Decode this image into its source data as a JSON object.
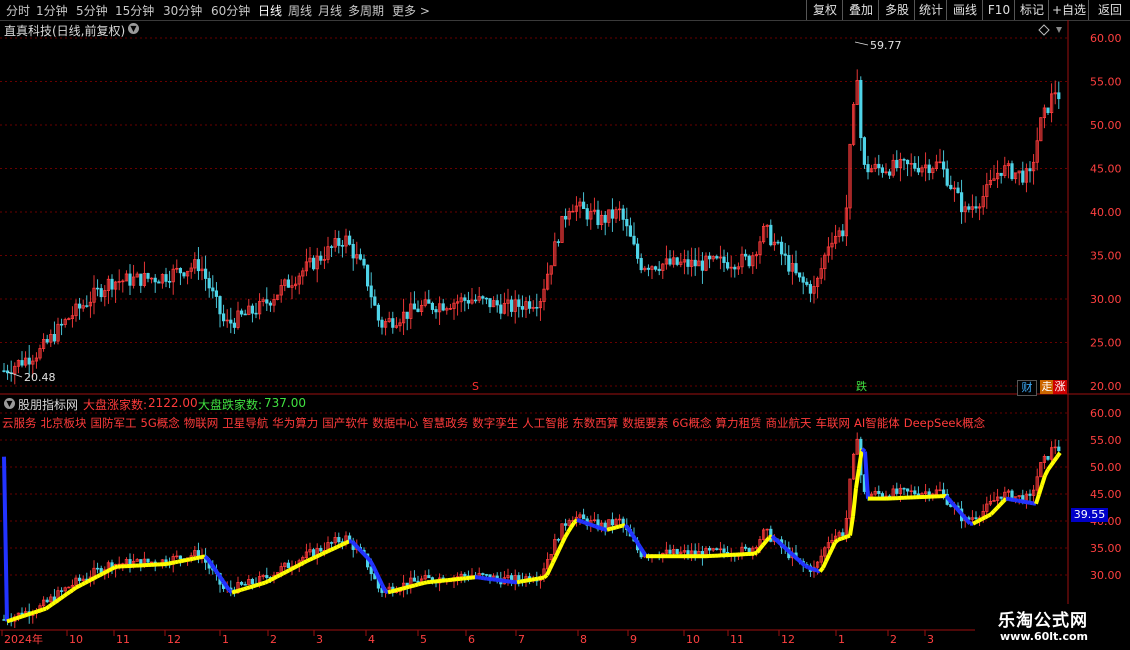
{
  "toolbar": {
    "left": [
      "分时",
      "1分钟",
      "5分钟",
      "15分钟",
      "30分钟",
      "60分钟",
      "日线",
      "周线",
      "月线",
      "多周期",
      "更多 >"
    ],
    "active": "日线",
    "right": [
      "复权",
      "叠加",
      "多股",
      "统计",
      "画线",
      "F10",
      "标记",
      "+自选",
      "返回"
    ]
  },
  "main": {
    "title": "直真科技(日线,前复权)",
    "high_label": "59.77",
    "low_label": "20.48",
    "axis": [
      "60.00",
      "55.00",
      "50.00",
      "45.00",
      "40.00",
      "35.00",
      "30.00",
      "25.00",
      "20.00"
    ],
    "marker_s": "S",
    "marker_die": "跌",
    "badge_cai": "财",
    "badge_zou": "走",
    "badge_zhang": "涨"
  },
  "sub": {
    "title": "股朋指标网",
    "up_label": "大盘涨家数:",
    "up_value": "2122.00",
    "down_label": "大盘跌家数:",
    "down_value": "737.00",
    "concepts": [
      "云服务",
      "北京板块",
      "国防军工",
      "5G概念",
      "物联网",
      "卫星导航",
      "华为算力",
      "国产软件",
      "数据中心",
      "智慧政务",
      "数字孪生",
      "人工智能",
      "东数西算",
      "数据要素",
      "6G概念",
      "算力租赁",
      "商业航天",
      "车联网",
      "AI智能体",
      "DeepSeek概念"
    ],
    "axis": [
      "60.00",
      "55.00",
      "50.00",
      "45.00",
      "40.00",
      "35.00",
      "30.00"
    ],
    "price_tag": "39.55"
  },
  "xaxis": [
    "2024年",
    "10",
    "11",
    "12",
    "1",
    "2",
    "3",
    "4",
    "5",
    "6",
    "7",
    "8",
    "9",
    "10",
    "11",
    "12",
    "1",
    "2",
    "3"
  ],
  "watermark": {
    "line1": "乐淘公式网",
    "line2": "www.60lt.com"
  },
  "colors": {
    "up": "#ff3c3c",
    "down": "#4fd4e8",
    "grid": "#8b0000",
    "line_yellow": "#ffff00",
    "line_blue": "#2233ff",
    "frame": "#9b1010"
  },
  "icons": {
    "chevron": "chevron-down-icon",
    "diamond": "diamond-icon"
  }
}
